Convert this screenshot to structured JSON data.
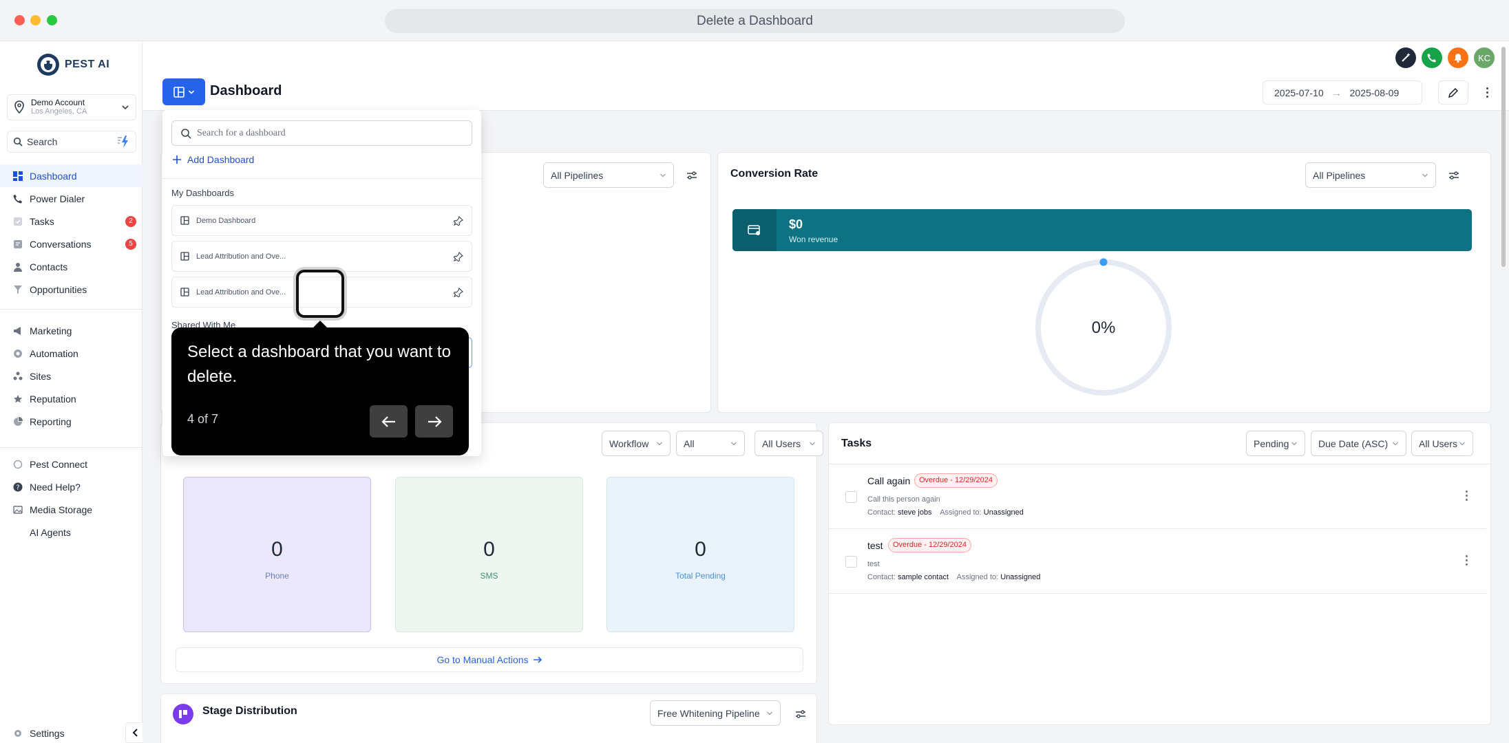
{
  "window": {
    "title": "Delete a Dashboard"
  },
  "brand": {
    "name": "PEST AI"
  },
  "account": {
    "name": "Demo Account",
    "location": "Los Angeles, CA"
  },
  "sidebar": {
    "search_label": "Search",
    "items": [
      {
        "label": "Dashboard",
        "icon": "dashboard-icon",
        "active": true
      },
      {
        "label": "Power Dialer",
        "icon": "phone-icon"
      },
      {
        "label": "Tasks",
        "icon": "checkbox-icon",
        "badge": "2"
      },
      {
        "label": "Conversations",
        "icon": "chat-icon",
        "badge": "5"
      },
      {
        "label": "Contacts",
        "icon": "person-icon"
      },
      {
        "label": "Opportunities",
        "icon": "filter-icon"
      },
      {
        "label": "Marketing",
        "icon": "megaphone-icon"
      },
      {
        "label": "Automation",
        "icon": "automation-icon"
      },
      {
        "label": "Sites",
        "icon": "sites-icon"
      },
      {
        "label": "Reputation",
        "icon": "star-icon"
      },
      {
        "label": "Reporting",
        "icon": "pie-icon"
      },
      {
        "label": "Pest Connect",
        "icon": "connect-icon"
      },
      {
        "label": "Need Help?",
        "icon": "help-icon"
      },
      {
        "label": "Media Storage",
        "icon": "image-icon"
      },
      {
        "label": "AI Agents",
        "icon": ""
      },
      {
        "label": "Settings",
        "icon": "gear-icon"
      }
    ]
  },
  "topbar": {
    "avatar_initials": "KC"
  },
  "header": {
    "title": "Dashboard",
    "date_from": "2025-07-10",
    "date_to": "2025-08-09"
  },
  "conversion": {
    "title": "Conversion Rate",
    "pipeline_select": "All Pipelines",
    "won_value": "$0",
    "won_label": "Won revenue",
    "rate": "0%",
    "rate_fraction": 0
  },
  "left_card": {
    "pipeline_select": "All Pipelines"
  },
  "manual_actions": {
    "filters": [
      "Workflow",
      "All",
      "All Users"
    ],
    "stats": [
      {
        "value": "0",
        "label": "Phone"
      },
      {
        "value": "0",
        "label": "SMS"
      },
      {
        "value": "0",
        "label": "Total Pending"
      }
    ],
    "link": "Go to Manual Actions"
  },
  "tasks": {
    "title": "Tasks",
    "filters": [
      "Pending",
      "Due Date (ASC)",
      "All Users"
    ],
    "items": [
      {
        "name": "Call again",
        "badge": "Overdue - 12/29/2024",
        "desc": "Call this person again",
        "contact_label": "Contact:",
        "contact": "steve jobs",
        "assigned_label": "Assigned to:",
        "assigned": "Unassigned"
      },
      {
        "name": "test",
        "badge": "Overdue - 12/29/2024",
        "desc": "test",
        "contact_label": "Contact:",
        "contact": "sample contact",
        "assigned_label": "Assigned to:",
        "assigned": "Unassigned"
      }
    ]
  },
  "stage": {
    "title": "Stage Distribution",
    "pipeline_select": "Free Whitening Pipeline"
  },
  "dropdown": {
    "search_placeholder": "Search for a dashboard",
    "add_label": "Add Dashboard",
    "my_section": "My Dashboards",
    "my_items": [
      "Demo Dashboard",
      "Lead Attribution and Ove...",
      "Lead Attribution and Ove..."
    ],
    "shared_section": "Shared With Me"
  },
  "tour": {
    "text": "Select a dashboard that you want to delete.",
    "step": "4 of 7"
  },
  "colors": {
    "accent": "#2563eb",
    "won_bar": "#0e7283",
    "overdue": "#dc2626"
  }
}
